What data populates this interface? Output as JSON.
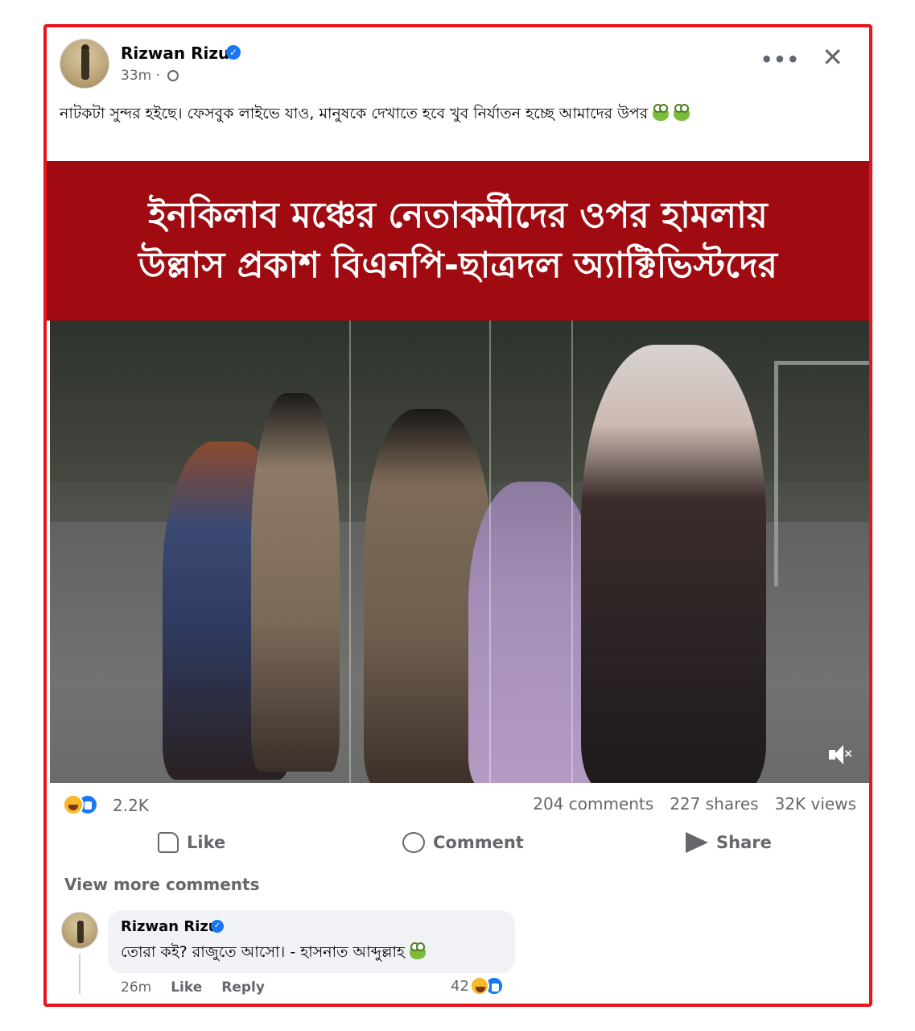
{
  "post": {
    "author": "Rizwan Rizu",
    "verified_mark": "✓",
    "time": "33m ·",
    "more_label": "•••",
    "close_label": "✕",
    "text": "নাটকটা সুন্দর হইছে। ফেসবুক লাইভে যাও, মানুষকে দেখাতে হবে খুব নির্যাতন হচ্ছে আমাদের উপর",
    "emoji": "frog"
  },
  "headline": {
    "line1": "ইনকিলাব মঞ্চের নেতাকর্মীদের ওপর হামলায়",
    "line2": "উল্লাস প্রকাশ বিএনপি-ছাত্রদল অ্যাক্টিভিস্টদের",
    "background": "#9f0b10"
  },
  "media": {
    "mute_label": "×"
  },
  "stats": {
    "reactions": "2.2K",
    "comments": "204 comments",
    "shares": "227 shares",
    "views": "32K views"
  },
  "actions": {
    "like": "Like",
    "comment": "Comment",
    "share": "Share"
  },
  "comments_section": {
    "view_more": "View more comments",
    "comment": {
      "author": "Rizwan Rizu",
      "verified_mark": "✓",
      "text": "তোরা কই? রাজুতে আসো। - হাসনাত আব্দুল্লাহ",
      "time": "26m",
      "like": "Like",
      "reply": "Reply",
      "reaction_count": "42"
    }
  },
  "colors": {
    "frame_border": "#e8141c",
    "accent": "#1877f2",
    "secondary_text": "#65676b"
  }
}
